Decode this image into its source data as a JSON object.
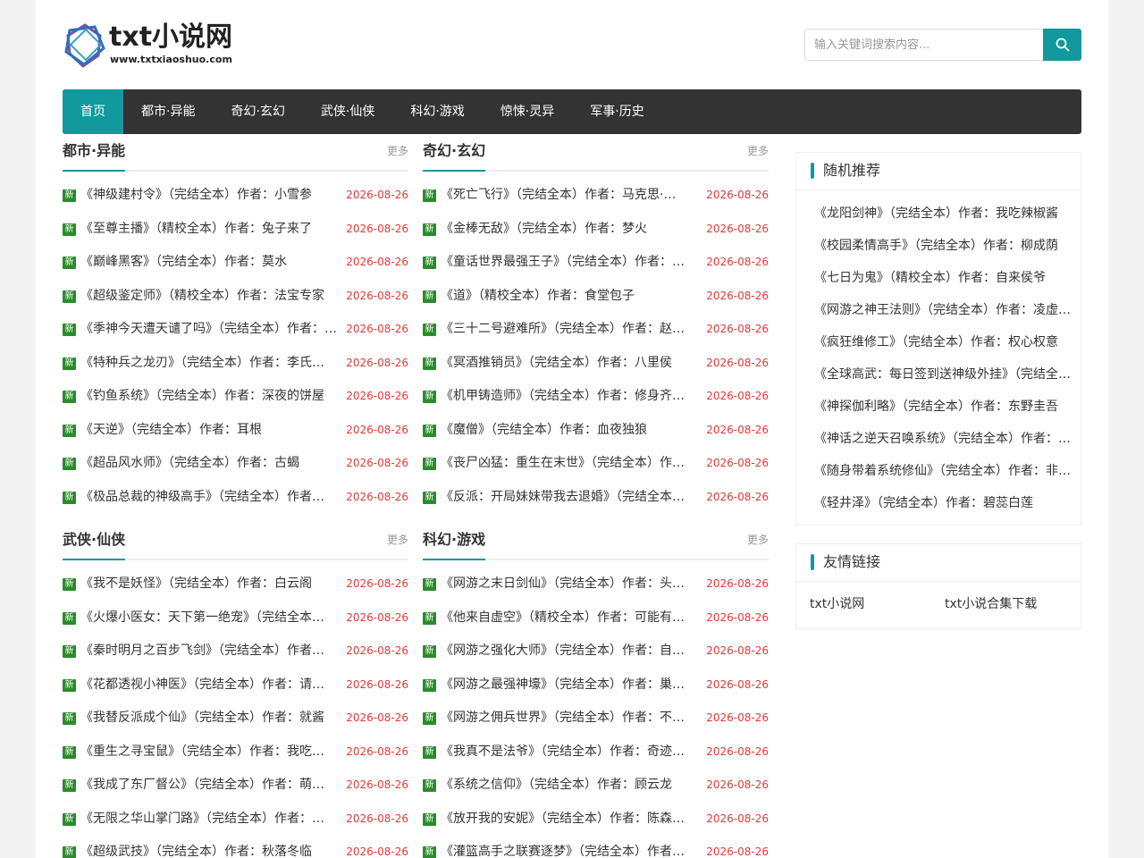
{
  "site": {
    "logo_text": "txt小说网",
    "logo_url_text": "www.txtxiaoshuo.com"
  },
  "search": {
    "placeholder": "输入关键词搜索内容...",
    "icon": "search-icon"
  },
  "nav": {
    "items": [
      "首页",
      "都市·异能",
      "奇幻·玄幻",
      "武侠·仙侠",
      "科幻·游戏",
      "惊悚·灵异",
      "军事·历史"
    ],
    "active": "首页"
  },
  "badge_text": "新",
  "more_label": "更多",
  "sections": [
    {
      "title": "都市·异能",
      "items": [
        {
          "title": "《神级建村令》（完结全本）作者：小雪参",
          "date": "2026-08-26"
        },
        {
          "title": "《至尊主播》（精校全本）作者：兔子来了",
          "date": "2026-08-26"
        },
        {
          "title": "《巅峰黑客》（完结全本）作者：莫水",
          "date": "2026-08-26"
        },
        {
          "title": "《超级鉴定师》（精校全本）作者：法宝专家",
          "date": "2026-08-26"
        },
        {
          "title": "《季神今天遭天谴了吗》（完结全本）作者：…",
          "date": "2026-08-26"
        },
        {
          "title": "《特种兵之龙刃》（完结全本）作者：李氏…",
          "date": "2026-08-26"
        },
        {
          "title": "《钓鱼系统》（完结全本）作者：深夜的饼屋",
          "date": "2026-08-26"
        },
        {
          "title": "《天逆》（完结全本）作者：耳根",
          "date": "2026-08-26"
        },
        {
          "title": "《超品风水师》（完结全本）作者：古蝎",
          "date": "2026-08-26"
        },
        {
          "title": "《极品总裁的神级高手》（完结全本）作者…",
          "date": "2026-08-26"
        }
      ]
    },
    {
      "title": "奇幻·玄幻",
      "items": [
        {
          "title": "《死亡飞行》（完结全本）作者：马克思·…",
          "date": "2026-08-26"
        },
        {
          "title": "《金棒无敌》（完结全本）作者：梦火",
          "date": "2026-08-26"
        },
        {
          "title": "《童话世界最强王子》（完结全本）作者：…",
          "date": "2026-08-26"
        },
        {
          "title": "《道》（精校全本）作者：食堂包子",
          "date": "2026-08-26"
        },
        {
          "title": "《三十二号避难所》（完结全本）作者：赵…",
          "date": "2026-08-26"
        },
        {
          "title": "《冥酒推销员》（完结全本）作者：八里侯",
          "date": "2026-08-26"
        },
        {
          "title": "《机甲铸造师》（完结全本）作者：修身齐…",
          "date": "2026-08-26"
        },
        {
          "title": "《魔僧》（完结全本）作者：血夜独狼",
          "date": "2026-08-26"
        },
        {
          "title": "《丧尸凶猛：重生在末世》（完结全本）作…",
          "date": "2026-08-26"
        },
        {
          "title": "《反派：开局妹妹带我去退婚》（完结全本…",
          "date": "2026-08-26"
        }
      ]
    },
    {
      "title": "武侠·仙侠",
      "items": [
        {
          "title": "《我不是妖怪》（完结全本）作者：白云阁",
          "date": "2026-08-26"
        },
        {
          "title": "《火爆小医女：天下第一绝宠》（完结全本…",
          "date": "2026-08-26"
        },
        {
          "title": "《秦时明月之百步飞剑》（完结全本）作者…",
          "date": "2026-08-26"
        },
        {
          "title": "《花都透视小神医》（完结全本）作者：请…",
          "date": "2026-08-26"
        },
        {
          "title": "《我替反派成个仙》（完结全本）作者：就酱",
          "date": "2026-08-26"
        },
        {
          "title": "《重生之寻宝鼠》（完结全本）作者：我吃…",
          "date": "2026-08-26"
        },
        {
          "title": "《我成了东厂督公》（完结全本）作者：萌…",
          "date": "2026-08-26"
        },
        {
          "title": "《无限之华山掌门路》（完结全本）作者：…",
          "date": "2026-08-26"
        },
        {
          "title": "《超级武技》（完结全本）作者：秋落冬临",
          "date": "2026-08-26"
        }
      ]
    },
    {
      "title": "科幻·游戏",
      "items": [
        {
          "title": "《网游之末日剑仙》（完结全本）作者：头…",
          "date": "2026-08-26"
        },
        {
          "title": "《他来自虚空》（精校全本）作者：可能有…",
          "date": "2026-08-26"
        },
        {
          "title": "《网游之强化大师》（完结全本）作者：自…",
          "date": "2026-08-26"
        },
        {
          "title": "《网游之最强神壕》（完结全本）作者：巢…",
          "date": "2026-08-26"
        },
        {
          "title": "《网游之佣兵世界》（完结全本）作者：不…",
          "date": "2026-08-26"
        },
        {
          "title": "《我真不是法爷》（完结全本）作者：奇迹…",
          "date": "2026-08-26"
        },
        {
          "title": "《系统之信仰》（完结全本）作者：顾云龙",
          "date": "2026-08-26"
        },
        {
          "title": "《放开我的安妮》（完结全本）作者：陈森…",
          "date": "2026-08-26"
        },
        {
          "title": "《灌篮高手之联赛逐梦》（完结全本）作者…",
          "date": "2026-08-26"
        }
      ]
    }
  ],
  "random": {
    "title": "随机推荐",
    "items": [
      "《龙阳剑神》（完结全本）作者：我吃辣椒酱",
      "《校园柔情高手》（完结全本）作者：柳成荫",
      "《七日为鬼》（精校全本）作者：自来侯爷",
      "《网游之神王法则》（完结全本）作者：凌虚…",
      "《疯狂维修工》（完结全本）作者：权心权意",
      "《全球高武：每日签到送神级外挂》（完结全…",
      "《神探伽利略》（完结全本）作者：东野圭吾",
      "《神话之逆天召唤系统》（完结全本）作者：…",
      "《随身带着系统修仙》（完结全本）作者：非…",
      "《轻井泽》（完结全本）作者：碧蕊白莲"
    ]
  },
  "friends": {
    "title": "友情链接",
    "links": [
      "txt小说网",
      "txt小说合集下载"
    ]
  },
  "colors": {
    "accent": "#11999e",
    "nav_bg": "#333333",
    "badge_bg": "#2a8c2a",
    "date": "#e53935"
  }
}
